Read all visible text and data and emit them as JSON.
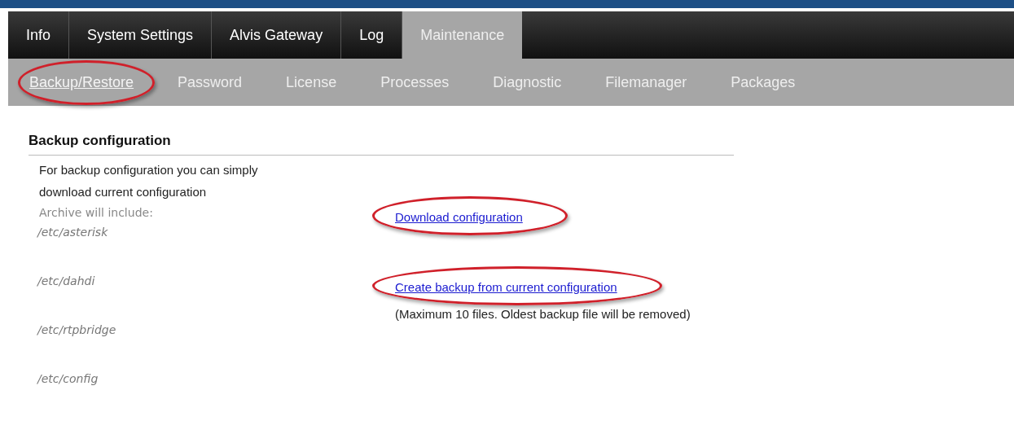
{
  "tabs": [
    {
      "label": "Info",
      "selected": false
    },
    {
      "label": "System Settings",
      "selected": false
    },
    {
      "label": "Alvis Gateway",
      "selected": false
    },
    {
      "label": "Log",
      "selected": false
    },
    {
      "label": "Maintenance",
      "selected": true
    }
  ],
  "subtabs": [
    {
      "label": "Backup/Restore",
      "selected": true,
      "circled": true
    },
    {
      "label": "Password",
      "selected": false,
      "circled": false
    },
    {
      "label": "License",
      "selected": false,
      "circled": false
    },
    {
      "label": "Processes",
      "selected": false,
      "circled": false
    },
    {
      "label": "Diagnostic",
      "selected": false,
      "circled": false
    },
    {
      "label": "Filemanager",
      "selected": false,
      "circled": false
    },
    {
      "label": "Packages",
      "selected": false,
      "circled": false
    }
  ],
  "section": {
    "title": "Backup configuration",
    "description": "For backup configuration you can simply download current configuration",
    "archive_label": "Archive will include:",
    "paths": [
      "/etc/asterisk",
      "/etc/dahdi",
      "/etc/rtpbridge",
      "/etc/config"
    ],
    "actions": [
      {
        "label": "Download configuration",
        "circled": true
      },
      {
        "label": "Create backup from current configuration",
        "circled": true,
        "note": "(Maximum 10 files. Oldest backup file will be removed)"
      }
    ]
  }
}
